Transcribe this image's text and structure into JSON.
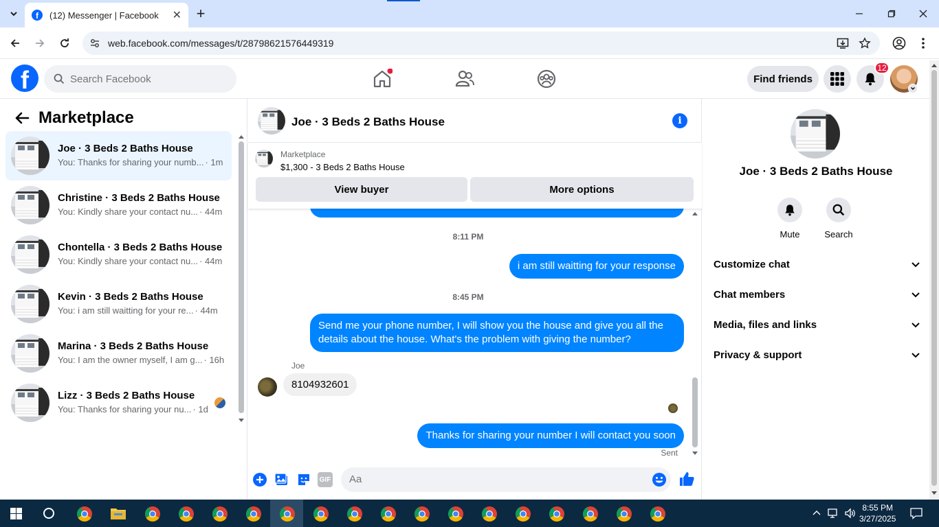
{
  "browser": {
    "tab_title": "(12) Messenger | Facebook",
    "url": "web.facebook.com/messages/t/28798621576449319"
  },
  "header": {
    "search_placeholder": "Search Facebook",
    "find_friends": "Find friends",
    "notif_count": "12"
  },
  "left_panel": {
    "title": "Marketplace",
    "conversations": [
      {
        "name": "Joe · 3 Beds 2 Baths House",
        "snippet": "You: Thanks for sharing your numb...",
        "time": "· 1m"
      },
      {
        "name": "Christine · 3 Beds 2 Baths House",
        "snippet": "You: Kindly share your contact nu...",
        "time": "· 44m"
      },
      {
        "name": "Chontella · 3 Beds 2 Baths House",
        "snippet": "You: Kindly share your contact nu...",
        "time": "· 44m"
      },
      {
        "name": "Kevin · 3 Beds 2 Baths House",
        "snippet": "You: i am still waitting for your re...",
        "time": "· 44m"
      },
      {
        "name": "Marina · 3 Beds 2 Baths House",
        "snippet": "You: I am the owner myself, I am g...",
        "time": "· 16h"
      },
      {
        "name": "Lizz · 3 Beds 2 Baths House",
        "snippet": "You: Thanks for sharing your nu...",
        "time": "· 1d"
      }
    ]
  },
  "chat": {
    "title": "Joe · 3 Beds 2 Baths House",
    "listing_category": "Marketplace",
    "listing_price": "$1,300 - 3 Beds 2 Baths House",
    "view_buyer": "View buyer",
    "more_options": "More options",
    "messages": {
      "time1": "8:11 PM",
      "out1": "i am still waitting for your response",
      "time2": "8:45 PM",
      "out2": "Send me your phone number, I will show you the house and give you all the details about the house. What's the problem with giving the number?",
      "sender": "Joe",
      "in1": "8104932601",
      "out3": "Thanks for sharing your number I will contact you soon",
      "sent": "Sent"
    },
    "composer_placeholder": "Aa",
    "gif": "GIF"
  },
  "right_panel": {
    "name": "Joe · 3 Beds 2 Baths House",
    "mute": "Mute",
    "search": "Search",
    "rows": [
      "Customize chat",
      "Chat members",
      "Media, files and links",
      "Privacy & support"
    ]
  },
  "taskbar": {
    "time": "8:55 PM",
    "date": "3/27/2025"
  },
  "colors": {
    "fb_blue": "#0866ff",
    "bubble_blue": "#0084ff",
    "taskbar": "#0c2942"
  }
}
